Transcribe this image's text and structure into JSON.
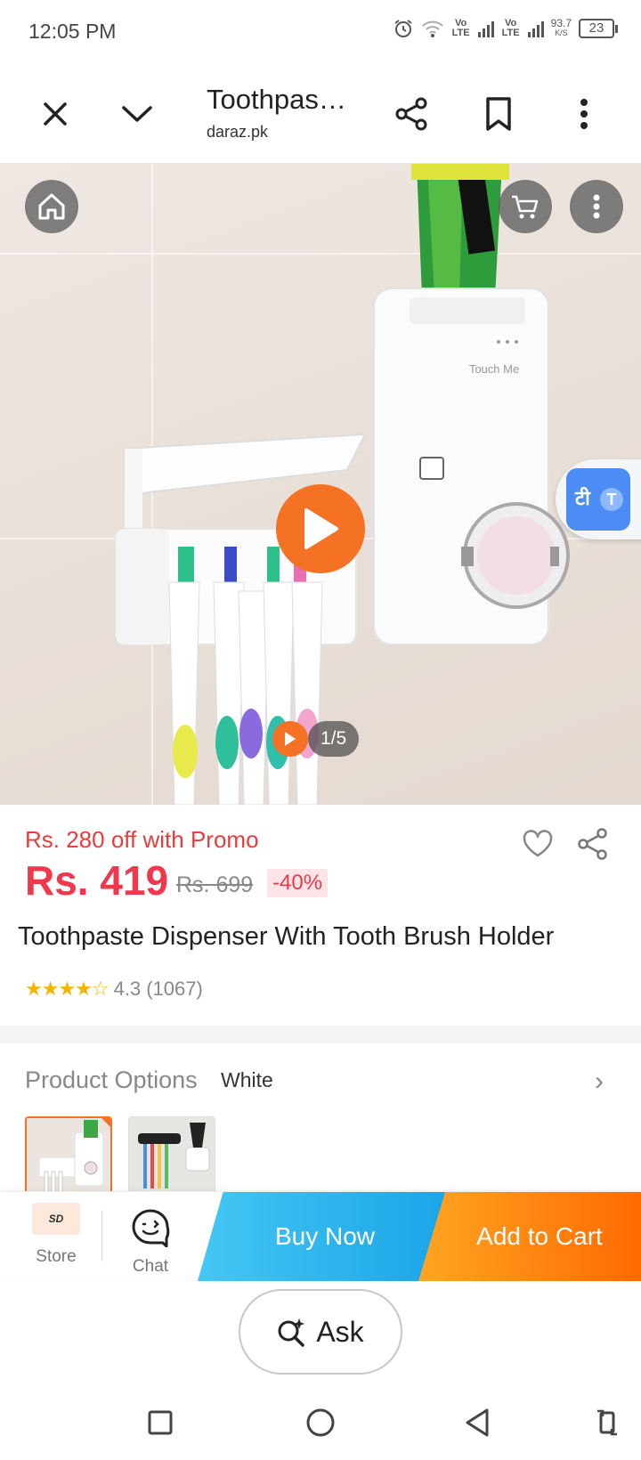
{
  "status_bar": {
    "time": "12:05 PM",
    "network_speed": "93.7",
    "network_unit": "K/S",
    "battery": "23",
    "sim1_label": "Vo LTE",
    "sim2_label": "Vo LTE"
  },
  "toolbar": {
    "title": "Toothpas…",
    "domain": "daraz.pk"
  },
  "hero": {
    "counter": "1/5",
    "translate_label_1": "टी",
    "translate_label_2": "T",
    "brand_text": "Touch Me"
  },
  "product": {
    "promo": "Rs. 280 off with Promo",
    "price": "Rs. 419",
    "old_price": "Rs. 699",
    "discount": "-40%",
    "title": "Toothpaste Dispenser With Tooth Brush Holder",
    "rating": "4.3",
    "reviews": "(1067)",
    "stars_filled": 4.3
  },
  "options": {
    "label": "Product Options",
    "value": "White"
  },
  "action_bar": {
    "store_logo": "SD",
    "store_label": "Store",
    "chat_label": "Chat",
    "buy_now": "Buy Now",
    "add_to_cart": "Add to Cart"
  },
  "ask": {
    "label": "Ask"
  },
  "colors": {
    "accent_orange": "#f57224",
    "price_red": "#f0374b",
    "buy_blue": "#1aa4e8"
  }
}
